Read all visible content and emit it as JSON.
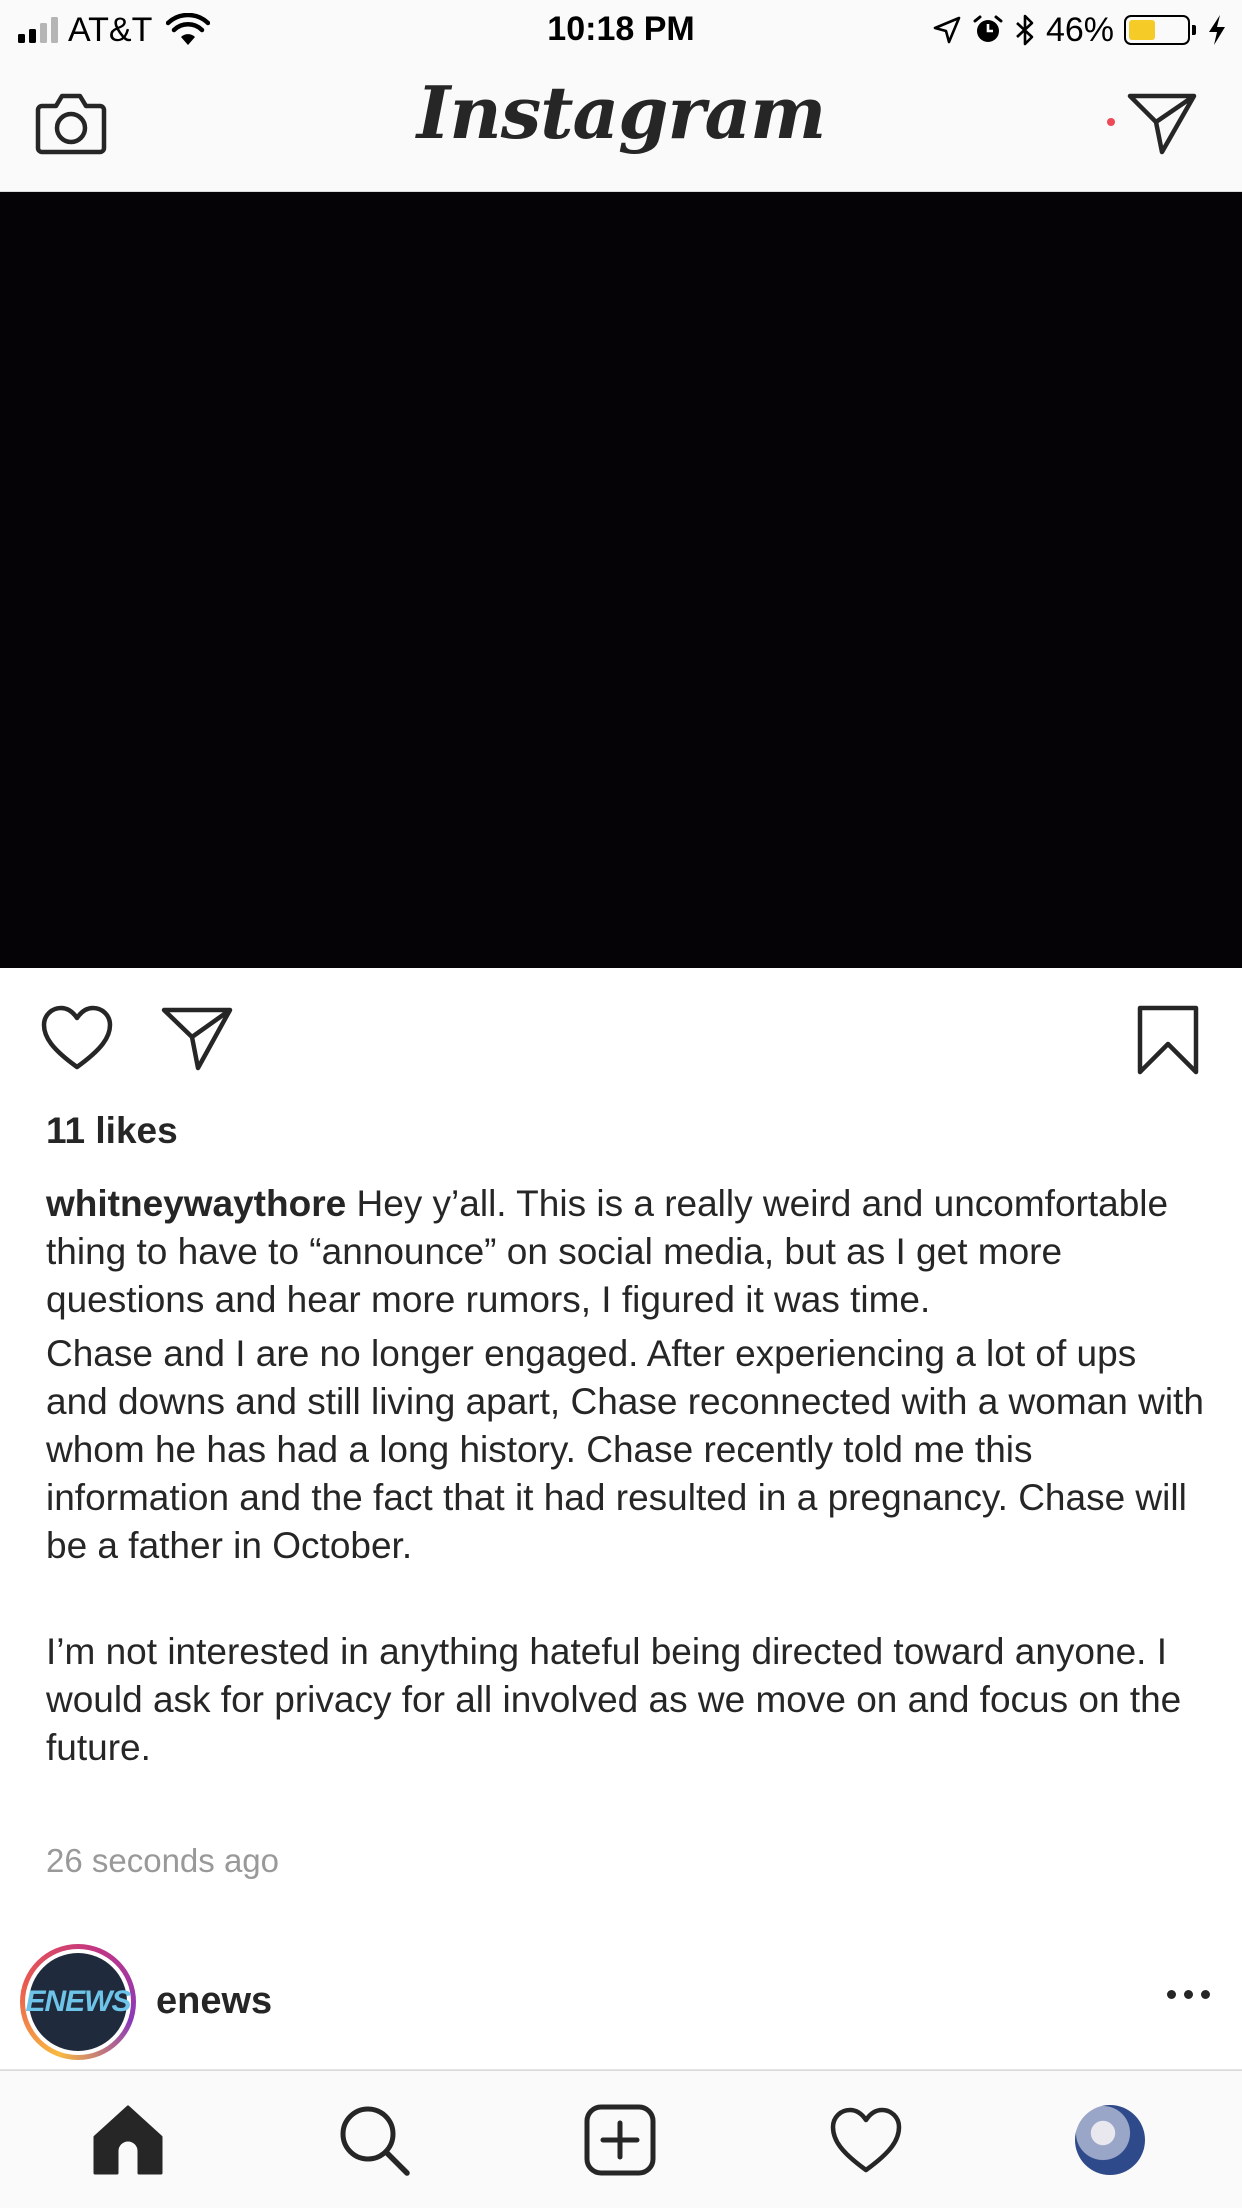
{
  "status_bar": {
    "carrier": "AT&T",
    "time": "10:18 PM",
    "battery_percent": "46%",
    "battery_level": 0.46,
    "icons": [
      "signal-icon",
      "wifi-icon",
      "location-icon",
      "alarm-icon",
      "bluetooth-icon",
      "battery-icon",
      "charging-icon"
    ]
  },
  "header": {
    "logo": "Instagram",
    "left_icon": "camera-icon",
    "right_icon": "direct-message-icon"
  },
  "post": {
    "likes": "11 likes",
    "username": "whitneywaythore",
    "caption_first": " Hey y’all. This is a really weird and uncomfortable thing to have to “announce” on social media, but as I get more questions and hear more rumors, I figured it was time.",
    "caption_second": "Chase and I are no longer engaged. After experiencing a lot of ups and downs and still living apart, Chase reconnected with a woman with whom he has had a long history. Chase recently told me this information and the fact that it had resulted in a pregnancy. Chase will be a father in October.",
    "caption_third": "I’m not interested in anything hateful being directed toward anyone. I would ask for privacy for all involved as we move on and focus on the future.",
    "timestamp": "26 seconds ago",
    "media_color": "#060307"
  },
  "next_post": {
    "username": "enews",
    "avatar_text": "ENEWS"
  },
  "tab_bar": {
    "items": [
      "home-icon",
      "search-icon",
      "add-post-icon",
      "activity-heart-icon",
      "profile-avatar"
    ],
    "notification_color": "#ed4956"
  },
  "colors": {
    "text": "#262626",
    "secondary_text": "#999999",
    "bar_background": "#fafafa",
    "battery_fill": "#f5cb27"
  }
}
